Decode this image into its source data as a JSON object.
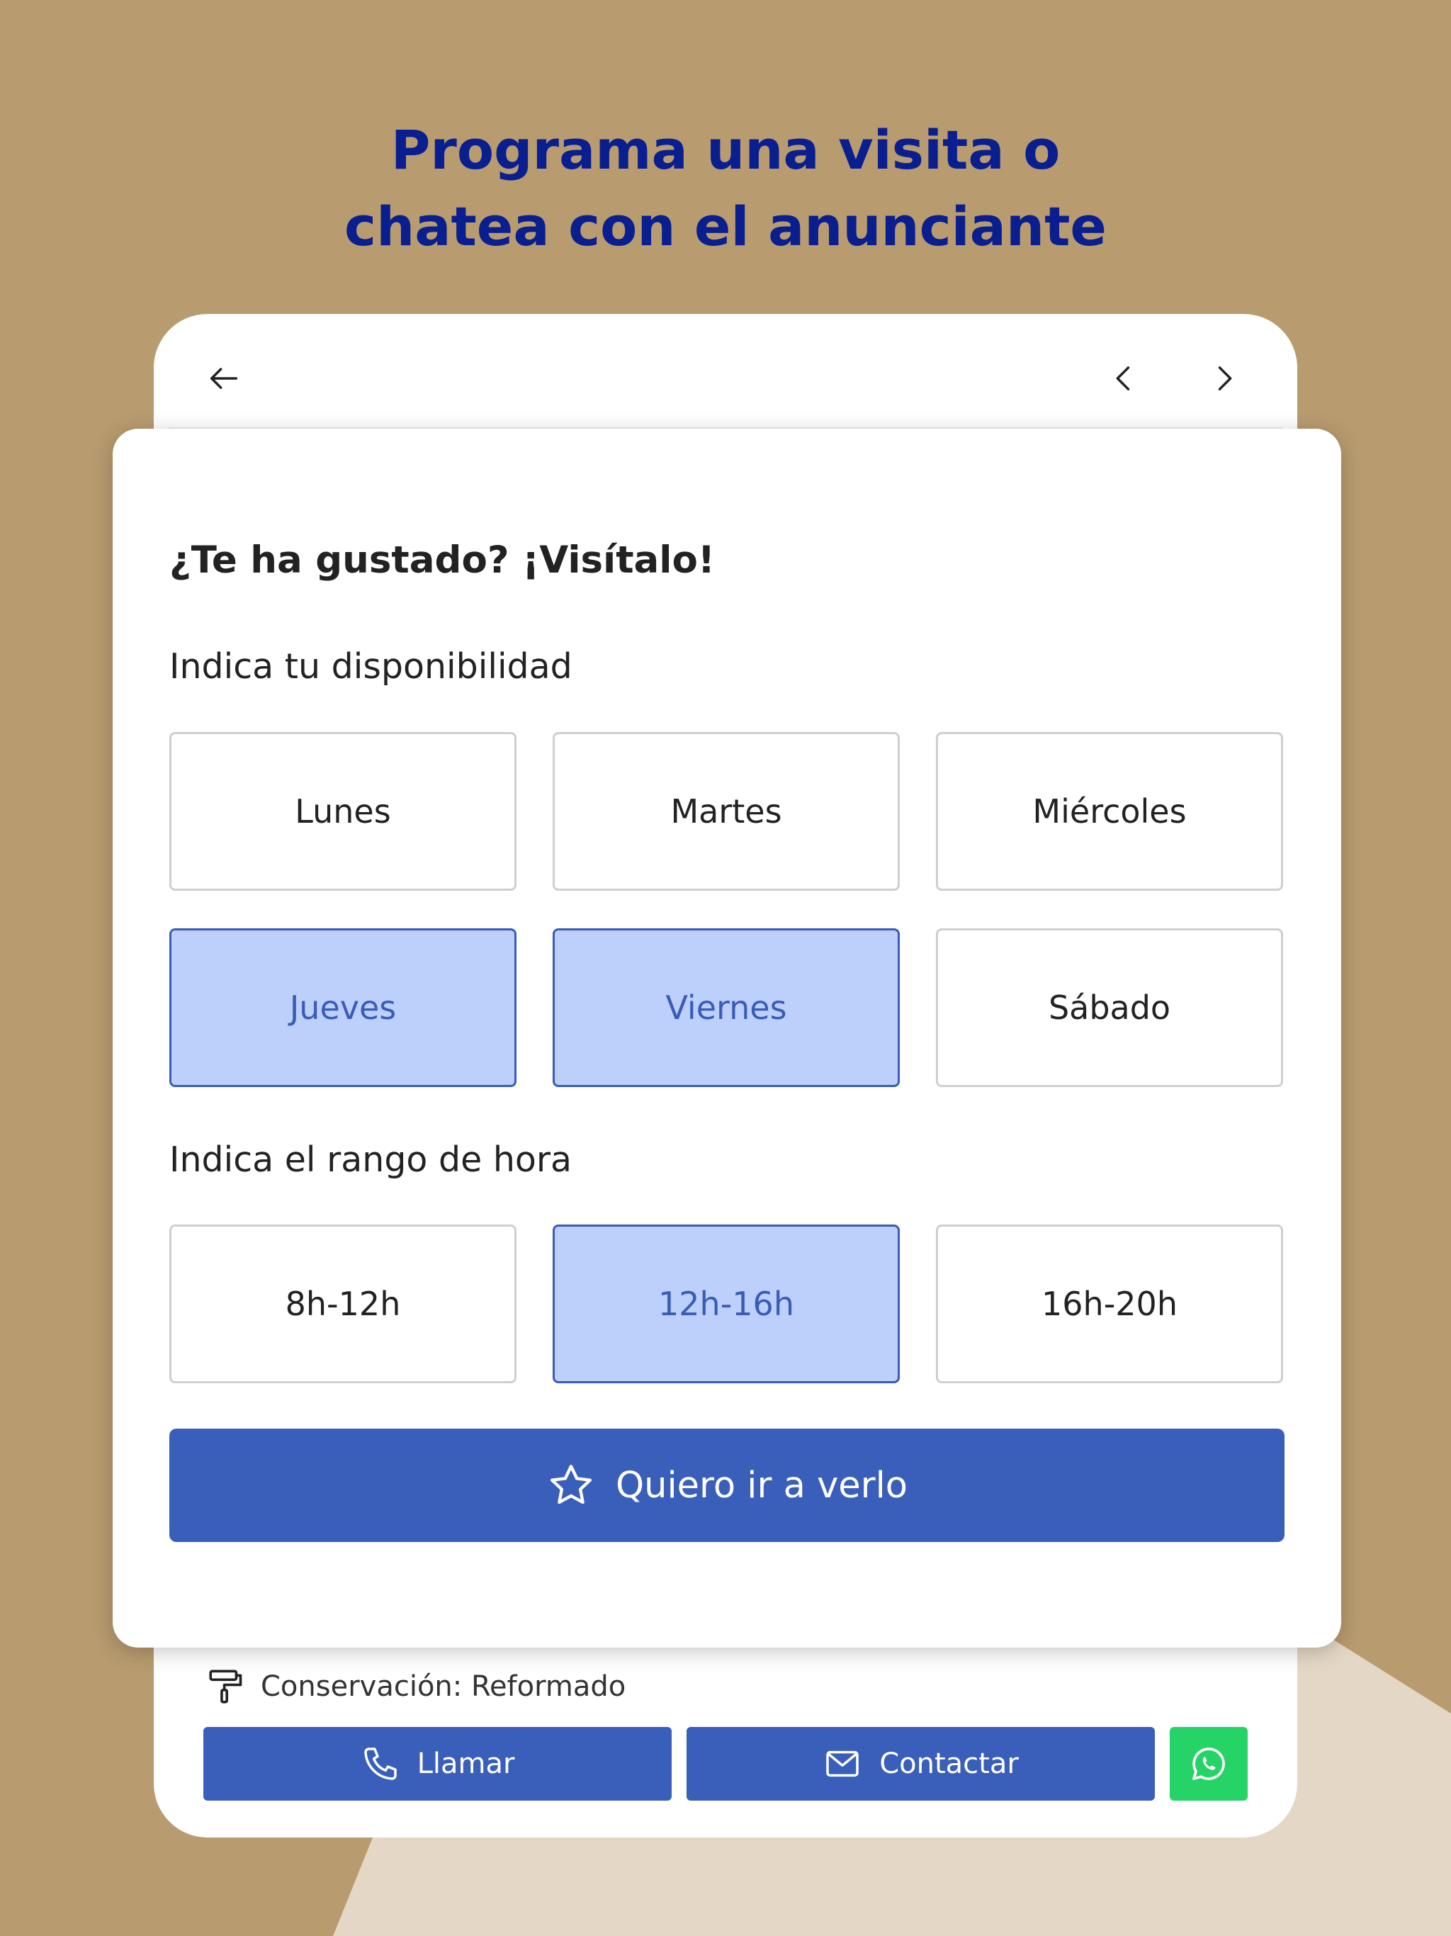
{
  "headline": {
    "line1": "Programa una visita o",
    "line2": "chatea con el anunciante"
  },
  "nav": {
    "back_icon": "arrow-left-icon",
    "prev_icon": "chevron-left-icon",
    "next_icon": "chevron-right-icon"
  },
  "modal": {
    "title": "¿Te ha gustado? ¡Visítalo!",
    "days_label": "Indica tu disponibilidad",
    "days": [
      {
        "label": "Lunes",
        "selected": false
      },
      {
        "label": "Martes",
        "selected": false
      },
      {
        "label": "Miércoles",
        "selected": false
      },
      {
        "label": "Jueves",
        "selected": true
      },
      {
        "label": "Viernes",
        "selected": true
      },
      {
        "label": "Sábado",
        "selected": false
      }
    ],
    "hours_label": "Indica el rango de hora",
    "hours": [
      {
        "label": "8h-12h",
        "selected": false
      },
      {
        "label": "12h-16h",
        "selected": true
      },
      {
        "label": "16h-20h",
        "selected": false
      }
    ],
    "cta_label": "Quiero ir a verlo",
    "cta_icon": "star-icon"
  },
  "listing": {
    "feature_text": "Conservación: Reformado",
    "feature_icon": "paint-roller-icon"
  },
  "actions": {
    "call_label": "Llamar",
    "contact_label": "Contactar",
    "whatsapp_icon": "whatsapp-icon"
  },
  "colors": {
    "background": "#b89b6f",
    "headline": "#0a1f8f",
    "primary": "#3a5fba",
    "selected_fill": "#bdd0fc",
    "whatsapp": "#25d366"
  }
}
